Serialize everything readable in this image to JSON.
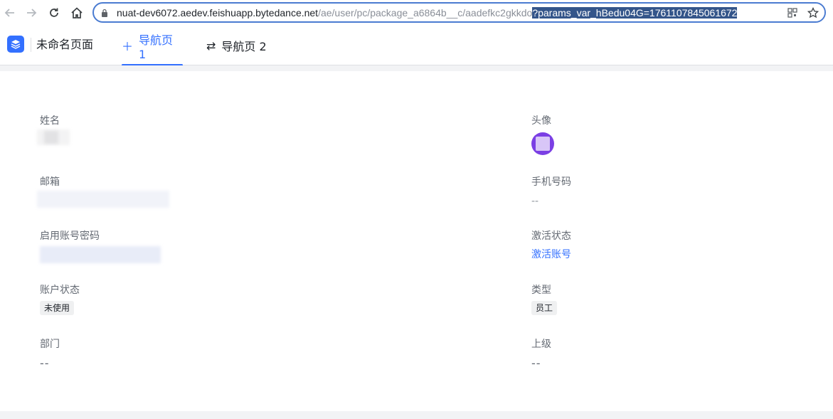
{
  "browser": {
    "url_host": "nuat-dev6072.aedev.feishuapp.bytedance.net",
    "url_path": "/ae/user/pc/package_a6864b__c/aadefkc2gkkdo",
    "url_selected": "?params_var_hBedu04G=1761107845061672"
  },
  "header": {
    "title": "未命名页面",
    "tabs": [
      {
        "label": "导航页 1",
        "icon": "plus-icon",
        "active": true
      },
      {
        "label": "导航页 2",
        "icon": "swap-icon",
        "active": false
      }
    ],
    "accent_color": "#3370ff"
  },
  "form": {
    "name": {
      "label": "姓名"
    },
    "avatar": {
      "label": "头像"
    },
    "email": {
      "label": "邮箱"
    },
    "phone": {
      "label": "手机号码",
      "value": "--"
    },
    "password": {
      "label": "启用账号密码"
    },
    "activation": {
      "label": "激活状态",
      "link": "激活账号"
    },
    "account_status": {
      "label": "账户状态",
      "tag": "未使用"
    },
    "type": {
      "label": "类型",
      "tag": "员工"
    },
    "department": {
      "label": "部门",
      "value": "--"
    },
    "superior": {
      "label": "上级",
      "value": "--"
    }
  }
}
